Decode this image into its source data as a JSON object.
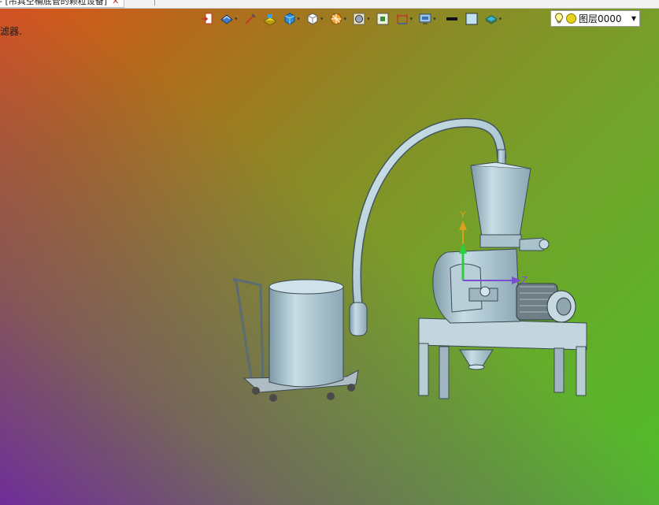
{
  "document_tab": {
    "title": "- [吊具空桶底管的颗粒设备]",
    "close_glyph": "✕"
  },
  "status_hint": "滤器.",
  "toolbar": {
    "items": [
      {
        "name": "exit-sketch-icon",
        "has_dropdown": false
      },
      {
        "name": "display-mode-icon",
        "has_dropdown": true
      },
      {
        "name": "measure-icon",
        "has_dropdown": false
      },
      {
        "name": "shaded-solid-icon",
        "has_dropdown": false
      },
      {
        "name": "view-cube-icon",
        "has_dropdown": true
      },
      {
        "name": "iso-view-icon",
        "has_dropdown": true
      },
      {
        "name": "section-view-icon",
        "has_dropdown": true
      },
      {
        "name": "render-sphere-icon",
        "has_dropdown": true
      },
      {
        "name": "fit-view-icon",
        "has_dropdown": false
      },
      {
        "name": "dimension-icon",
        "has_dropdown": true
      },
      {
        "name": "display-settings-icon",
        "has_dropdown": true
      },
      {
        "name": "line-style-icon",
        "has_dropdown": false
      },
      {
        "name": "color-swatch-icon",
        "has_dropdown": false
      },
      {
        "name": "layer-stack-icon",
        "has_dropdown": true
      }
    ]
  },
  "layer_selector": {
    "value": "图层0000",
    "bulb_color": "#f2d21a"
  },
  "axes": {
    "y_label": "Y",
    "z_label": "Z"
  },
  "colors": {
    "part_fill": "#a9c6d2",
    "part_stroke": "#3c4a52",
    "axis_y": "#d9a21c",
    "axis_green": "#2ecc40",
    "axis_z": "#7a4fd0"
  }
}
